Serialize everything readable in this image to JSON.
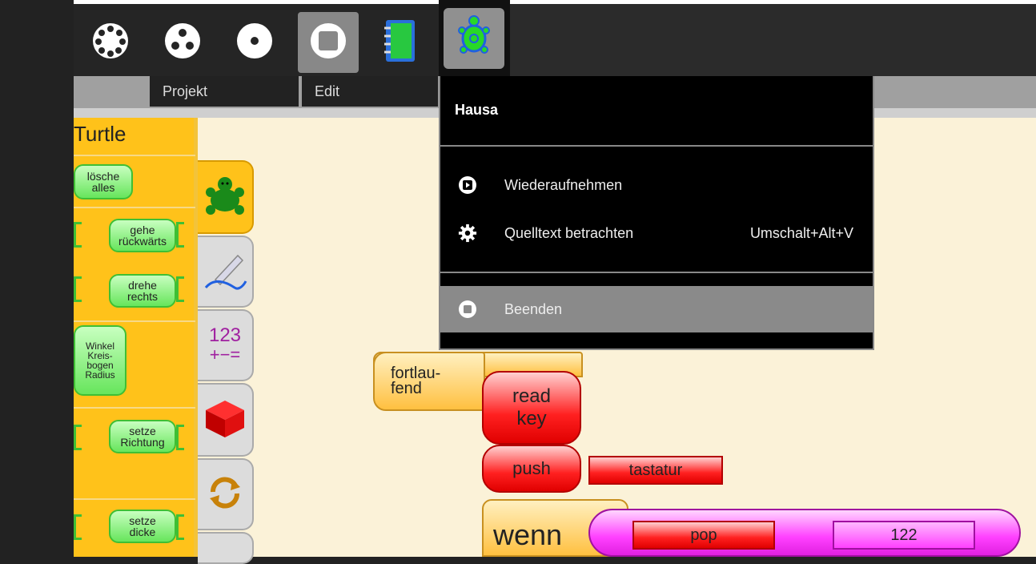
{
  "toolbar": {
    "buttons": [
      {
        "name": "run-slow-button",
        "icon": "dots-circle-icon"
      },
      {
        "name": "run-step-button",
        "icon": "three-dots-icon"
      },
      {
        "name": "run-fast-button",
        "icon": "one-dot-icon"
      },
      {
        "name": "stop-button",
        "icon": "stop-square-icon"
      },
      {
        "name": "notebook-button",
        "icon": "notebook-icon"
      },
      {
        "name": "turtle-menu-button",
        "icon": "turtle-icon"
      }
    ]
  },
  "menubar": {
    "projekt_label": "Projekt",
    "edit_label": "Edit"
  },
  "palette": {
    "title": "Turtle",
    "blocks": {
      "clear": "lösche\nalles",
      "back": "gehe\nrückwärts",
      "right": "drehe\nrechts",
      "arc": "Winkel\nKreis-\nbogen\nRadius",
      "heading": "setze\nRichtung",
      "pensize": "setze\ndicke"
    },
    "tabs": [
      {
        "name": "turtle-tab",
        "icon": "turtle-icon"
      },
      {
        "name": "pen-tab",
        "icon": "pen-icon"
      },
      {
        "name": "number-tab",
        "top": "123",
        "bottom": "+−="
      },
      {
        "name": "boxes-tab",
        "icon": "box-icon"
      },
      {
        "name": "flow-tab",
        "icon": "loop-arrows-icon"
      }
    ]
  },
  "menu": {
    "header": "Hausa",
    "items": [
      {
        "icon": "play-icon",
        "label": "Wiederaufnehmen",
        "shortcut": ""
      },
      {
        "icon": "gear-icon",
        "label": "Quelltext betrachten",
        "shortcut": "Umschalt+Alt+V"
      },
      {
        "icon": "stop-icon",
        "label": "Beenden",
        "shortcut": ""
      }
    ]
  },
  "canvas": {
    "forever": "fortlau-\nfend",
    "readkey": "read\nkey",
    "push": "push",
    "tastatur": "tastatur",
    "wenn": "wenn",
    "pop": "pop",
    "eq": "=",
    "num": "122"
  },
  "colors": {
    "accent": "#3fbf34",
    "menu_highlight": "#8a8a8a",
    "block_red": "#ff2020",
    "block_pink": "#ff40ff"
  }
}
